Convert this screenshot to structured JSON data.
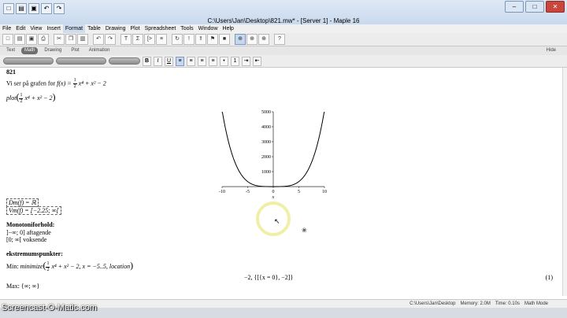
{
  "window": {
    "title": "C:\\Users\\Jan\\Desktop\\821.mw* - [Server 1] - Maple 16"
  },
  "menu": [
    "File",
    "Edit",
    "View",
    "Insert",
    "Format",
    "Table",
    "Drawing",
    "Plot",
    "Spreadsheet",
    "Tools",
    "Window",
    "Help"
  ],
  "active_menu": "Format",
  "toolbar_icons": [
    "new-icon",
    "open-icon",
    "save-icon",
    "print-icon",
    "cut-icon",
    "copy-icon",
    "paste-icon",
    "undo-icon",
    "redo-icon",
    "text-icon",
    "math-icon",
    "execution-group-icon",
    "section-icon",
    "restart-icon",
    "execute-icon",
    "execute-all-icon",
    "debug-icon",
    "stop-icon",
    "zoom-100-icon",
    "zoom-150-icon",
    "zoom-200-icon",
    "help-icon"
  ],
  "context_tabs": [
    "Text",
    "Math",
    "Drawing",
    "Plot",
    "Animation"
  ],
  "selected_tab": "Math",
  "hide_label": "Hide",
  "doc": {
    "header": "821",
    "line1_text": "Vi ser på grafen for",
    "line1_fx": "f(x) =",
    "half_num": "1",
    "half_den": "2",
    "line1_rest": "x⁴ + x² − 2",
    "plot_cmd": "plot",
    "plot_args_rest": "x⁴ + x² − 2",
    "dm": "Dm(f) = ℝ",
    "vm": "Vm(f) = [−2.25; ∞[",
    "monotoni_title": "Monotoniforhold:",
    "mono1": "]−∞; 0] aftagende",
    "mono2": "[0; ∞[ voksende",
    "ekstremum_title": "ekstremumspunkter:",
    "min_label": "Min:",
    "min_cmd": "minimize",
    "min_args_rest": "x⁴ + x² − 2, x = −5..5, location",
    "max_label": "Max: {∞; ∞}",
    "output": "−2, {[{x = 0}, −2]}",
    "eq_number": "(1)"
  },
  "chart_data": {
    "type": "line",
    "function": "1/2*x^4 + x^2 - 2",
    "xlim": [
      -10,
      10
    ],
    "ylim": [
      -50,
      5000
    ],
    "xticks": [
      -10,
      -5,
      0,
      5,
      10
    ],
    "yticks": [
      1000,
      2000,
      3000,
      4000,
      5000
    ],
    "xlabel": "x",
    "grid": false
  },
  "status": {
    "path": "C:\\Users\\Jan\\Desktop",
    "memory": "Memory: 2.0M",
    "time": "Time: 0.10s",
    "mode": "Math Mode"
  },
  "watermark": "Screencast-O-Matic.com"
}
